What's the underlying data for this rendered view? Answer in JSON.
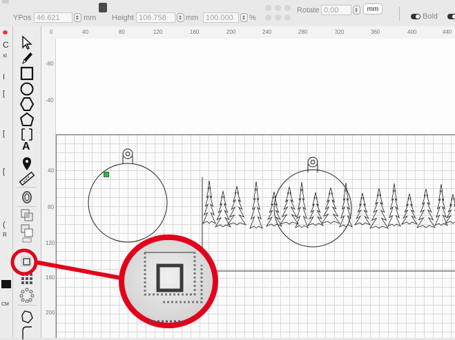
{
  "toolbar": {
    "ypos_label": "YPos",
    "ypos_value": "46.621",
    "ypos_unit": "mm",
    "height_label": "Height",
    "height_value": "106.758",
    "height_unit": "mm",
    "scale_value": "100.000",
    "scale_unit": "%",
    "rotate_label": "Rotate",
    "rotate_value": "0,00",
    "units_button": "mm",
    "bold_label": "Bold"
  },
  "hruler_ticks": [
    "0",
    "40",
    "80",
    "120",
    "160",
    "200",
    "240",
    "280",
    "320",
    "360",
    "400",
    "440"
  ],
  "vruler_ticks": [
    "-80",
    "-40",
    "40",
    "80",
    "120",
    "160",
    "200"
  ],
  "tools": [
    {
      "name": "select-arrow-icon"
    },
    {
      "name": "pencil-icon"
    },
    {
      "name": "rectangle-icon"
    },
    {
      "name": "ellipse-icon"
    },
    {
      "name": "polygon-icon"
    },
    {
      "name": "pentagon-icon"
    },
    {
      "name": "bracket-icon"
    },
    {
      "name": "text-icon",
      "label": "A"
    },
    {
      "name": "pin-icon"
    },
    {
      "name": "ruler-icon"
    },
    {
      "name": "offset-icon"
    },
    {
      "name": "boolean-union-icon"
    },
    {
      "name": "boolean-subtract-icon"
    },
    {
      "name": "boolean-intersect-icon"
    },
    {
      "name": "offset-shapes-icon"
    },
    {
      "name": "grid-array-icon"
    },
    {
      "name": "circular-array-icon"
    },
    {
      "name": "node-edit-icon"
    },
    {
      "name": "trim-icon"
    }
  ],
  "callout": {
    "color": "#e3001b",
    "target": "offset-shapes-icon"
  },
  "left_strip": [
    "C",
    "xi",
    "I",
    "[",
    "[",
    "[",
    "(",
    "R",
    "CM"
  ]
}
